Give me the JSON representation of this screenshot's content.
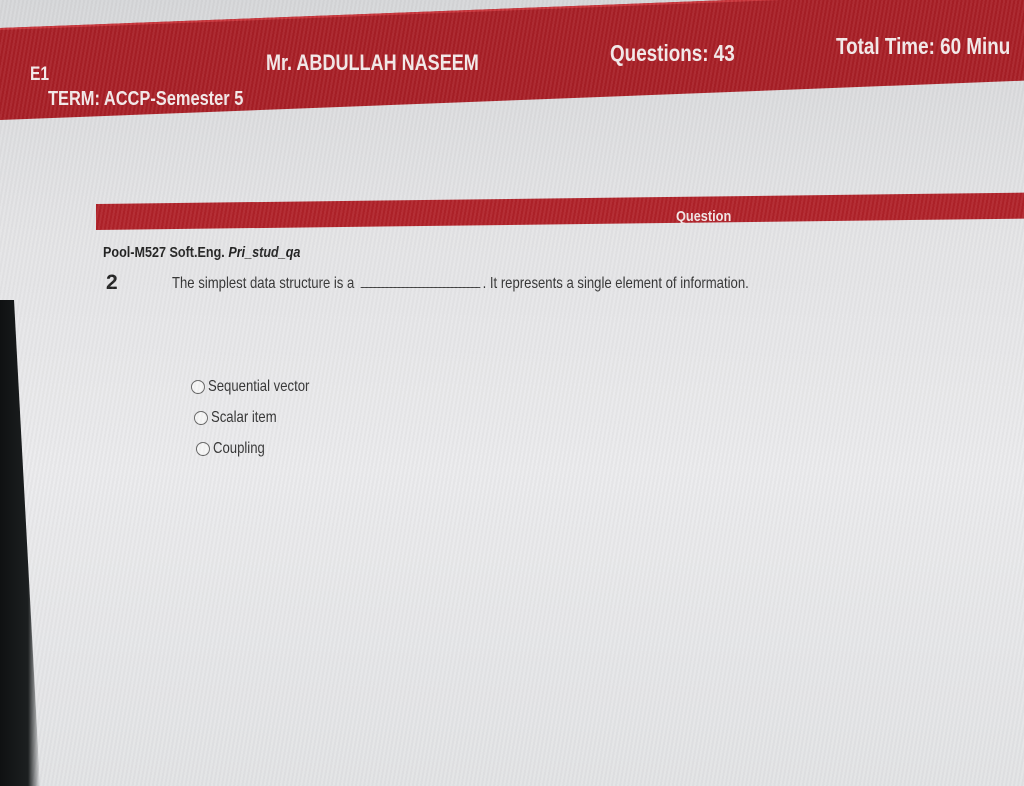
{
  "header": {
    "code": "E1",
    "term": "TERM: ACCP-Semester 5",
    "teacher": "Mr. ABDULLAH NASEEM",
    "questions": "Questions:  43",
    "total_time": "Total Time:  60 Minu"
  },
  "question_panel": {
    "bar_label": "Question",
    "pool_prefix": "Pool-M527 Soft.Eng. ",
    "pool_italic": "Pri_stud_qa",
    "number": "2",
    "text_before_blank": "The simplest data structure is a",
    "text_after_blank": ". It represents a single element of information.",
    "options": [
      {
        "label": "Sequential vector"
      },
      {
        "label": "Scalar item"
      },
      {
        "label": "Coupling"
      }
    ]
  },
  "colors": {
    "header_red": "#a81f26",
    "question_bar_red": "#b02229",
    "screen_bg": "#e4e4e6",
    "bezel": "#1a1c1d"
  },
  "icons": [
    "radio-button-icon"
  ]
}
